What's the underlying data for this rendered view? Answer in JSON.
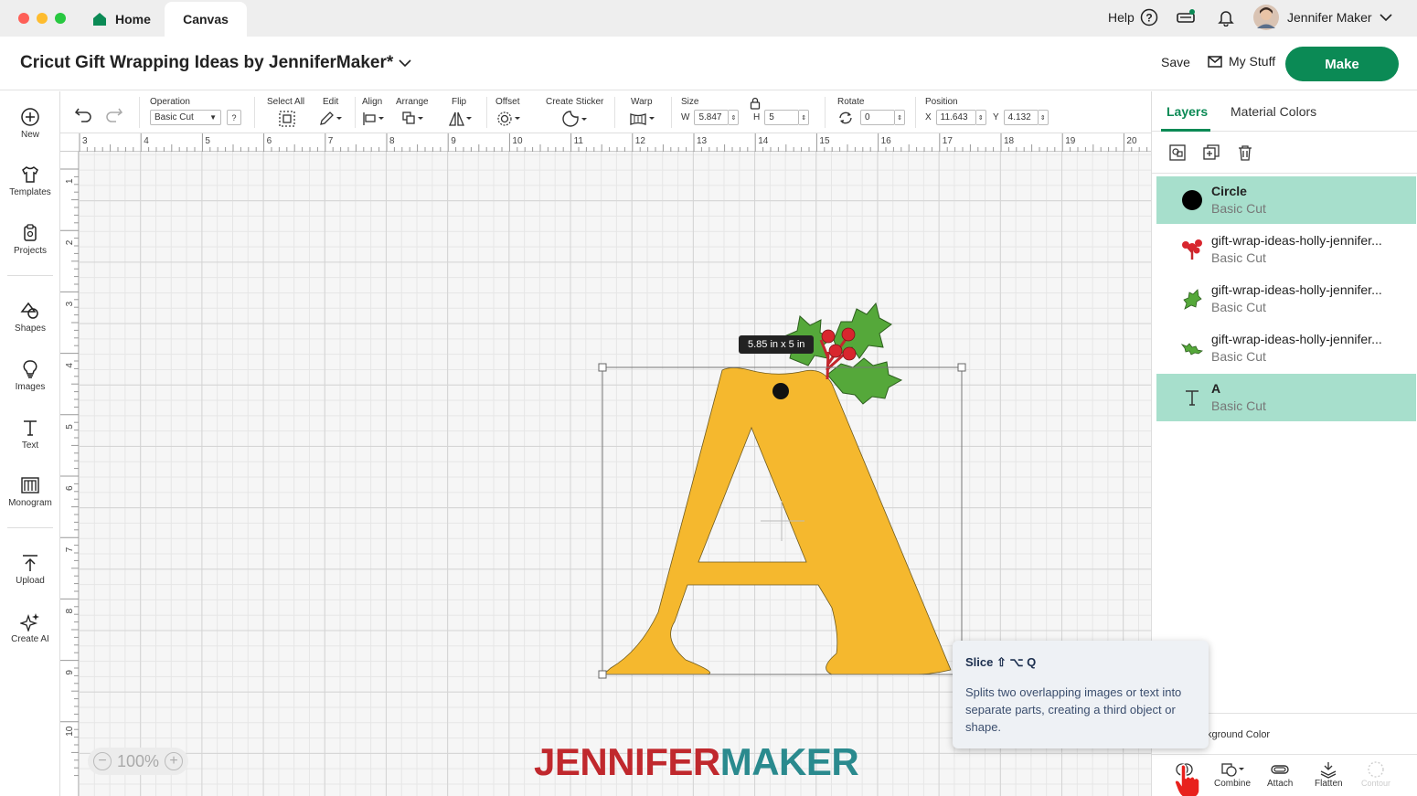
{
  "titlebar": {
    "tab_home": "Home",
    "tab_canvas": "Canvas",
    "help": "Help",
    "user": "Jennifer Maker"
  },
  "header": {
    "project_title": "Cricut Gift Wrapping Ideas by JenniferMaker*",
    "save": "Save",
    "my_stuff": "My Stuff",
    "make": "Make"
  },
  "leftbar": {
    "items": [
      {
        "label": "New",
        "icon": "plus-circle-icon"
      },
      {
        "label": "Templates",
        "icon": "shirt-icon"
      },
      {
        "label": "Projects",
        "icon": "clipboard-icon"
      },
      {
        "label": "Shapes",
        "icon": "shapes-icon"
      },
      {
        "label": "Images",
        "icon": "lightbulb-icon"
      },
      {
        "label": "Text",
        "icon": "text-icon"
      },
      {
        "label": "Monogram",
        "icon": "monogram-icon"
      },
      {
        "label": "Upload",
        "icon": "upload-icon"
      },
      {
        "label": "Create AI",
        "icon": "sparkle-icon"
      }
    ]
  },
  "toolbar": {
    "operation_label": "Operation",
    "operation_value": "Basic Cut",
    "select_all": "Select All",
    "edit": "Edit",
    "align": "Align",
    "arrange": "Arrange",
    "flip": "Flip",
    "offset": "Offset",
    "create_sticker": "Create Sticker",
    "warp": "Warp",
    "size_label": "Size",
    "w_label": "W",
    "w_value": "5.847",
    "h_label": "H",
    "h_value": "5",
    "rotate_label": "Rotate",
    "rotate_value": "0",
    "position_label": "Position",
    "x_label": "X",
    "x_value": "11.643",
    "y_label": "Y",
    "y_value": "4.132"
  },
  "rulers": {
    "top": [
      "3",
      "4",
      "5",
      "6",
      "7",
      "8",
      "9",
      "10",
      "11",
      "12",
      "13",
      "14",
      "15",
      "16",
      "17",
      "18",
      "19",
      "20"
    ],
    "left": [
      "1",
      "2",
      "3",
      "4",
      "5",
      "6",
      "7",
      "8",
      "9",
      "10"
    ]
  },
  "canvas": {
    "dimension_label": "5.85  in x 5  in",
    "zoom": "100%",
    "watermark_part1": "JENNIFER",
    "watermark_part2": "MAKER",
    "colors": {
      "letter": "#f5b82e",
      "holly_leaf": "#55a83a",
      "berry": "#d8262e",
      "circle": "#111111"
    }
  },
  "rightpanel": {
    "tab_layers": "Layers",
    "tab_material_colors": "Material Colors",
    "layers": [
      {
        "name": "Circle",
        "op": "Basic Cut",
        "icon": "circle-icon",
        "selected": true
      },
      {
        "name": "gift-wrap-ideas-holly-jennifer...",
        "op": "Basic Cut",
        "icon": "berries-icon",
        "selected": false
      },
      {
        "name": "gift-wrap-ideas-holly-jennifer...",
        "op": "Basic Cut",
        "icon": "leaf-icon",
        "selected": false
      },
      {
        "name": "gift-wrap-ideas-holly-jennifer...",
        "op": "Basic Cut",
        "icon": "leaf-icon",
        "selected": false
      },
      {
        "name": "A",
        "op": "Basic Cut",
        "icon": "text-icon",
        "selected": true
      }
    ],
    "background_color": "kground Color",
    "bottom": {
      "combine": "Combine",
      "attach": "Attach",
      "flatten": "Flatten",
      "contour": "Contour"
    }
  },
  "tooltip": {
    "title": "Slice ⇧ ⌥ Q",
    "body": "Splits two overlapping images or text into separate parts, creating a third object or shape."
  }
}
